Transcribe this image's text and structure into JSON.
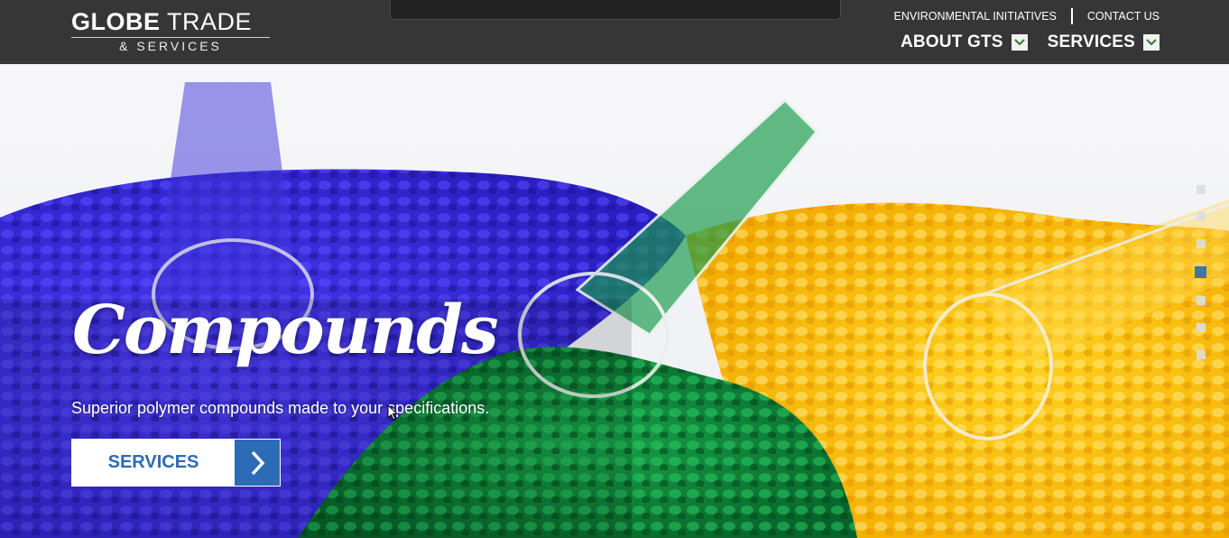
{
  "header": {
    "logo": {
      "main_bold": "GLOBE",
      "main_light": " TRADE",
      "sub": "& SERVICES"
    },
    "top_links": [
      "ENVIRONMENTAL INITIATIVES",
      "CONTACT US"
    ],
    "nav": [
      {
        "label": "ABOUT GTS",
        "icon": "chevron-down-icon"
      },
      {
        "label": "SERVICES",
        "icon": "chevron-down-icon"
      }
    ]
  },
  "hero": {
    "title": "Compounds",
    "subtitle": "Superior polymer compounds made to your specifications.",
    "cta_label": "SERVICES",
    "cta_icon": "chevron-right-icon",
    "slide_count": 7,
    "active_slide_index": 3
  },
  "colors": {
    "header_bg": "#363636",
    "accent": "#2c6bb6",
    "blue_pellets": "#3a2ee0",
    "green_pellets": "#0f8c3c",
    "yellow_pellets": "#ffc400"
  }
}
